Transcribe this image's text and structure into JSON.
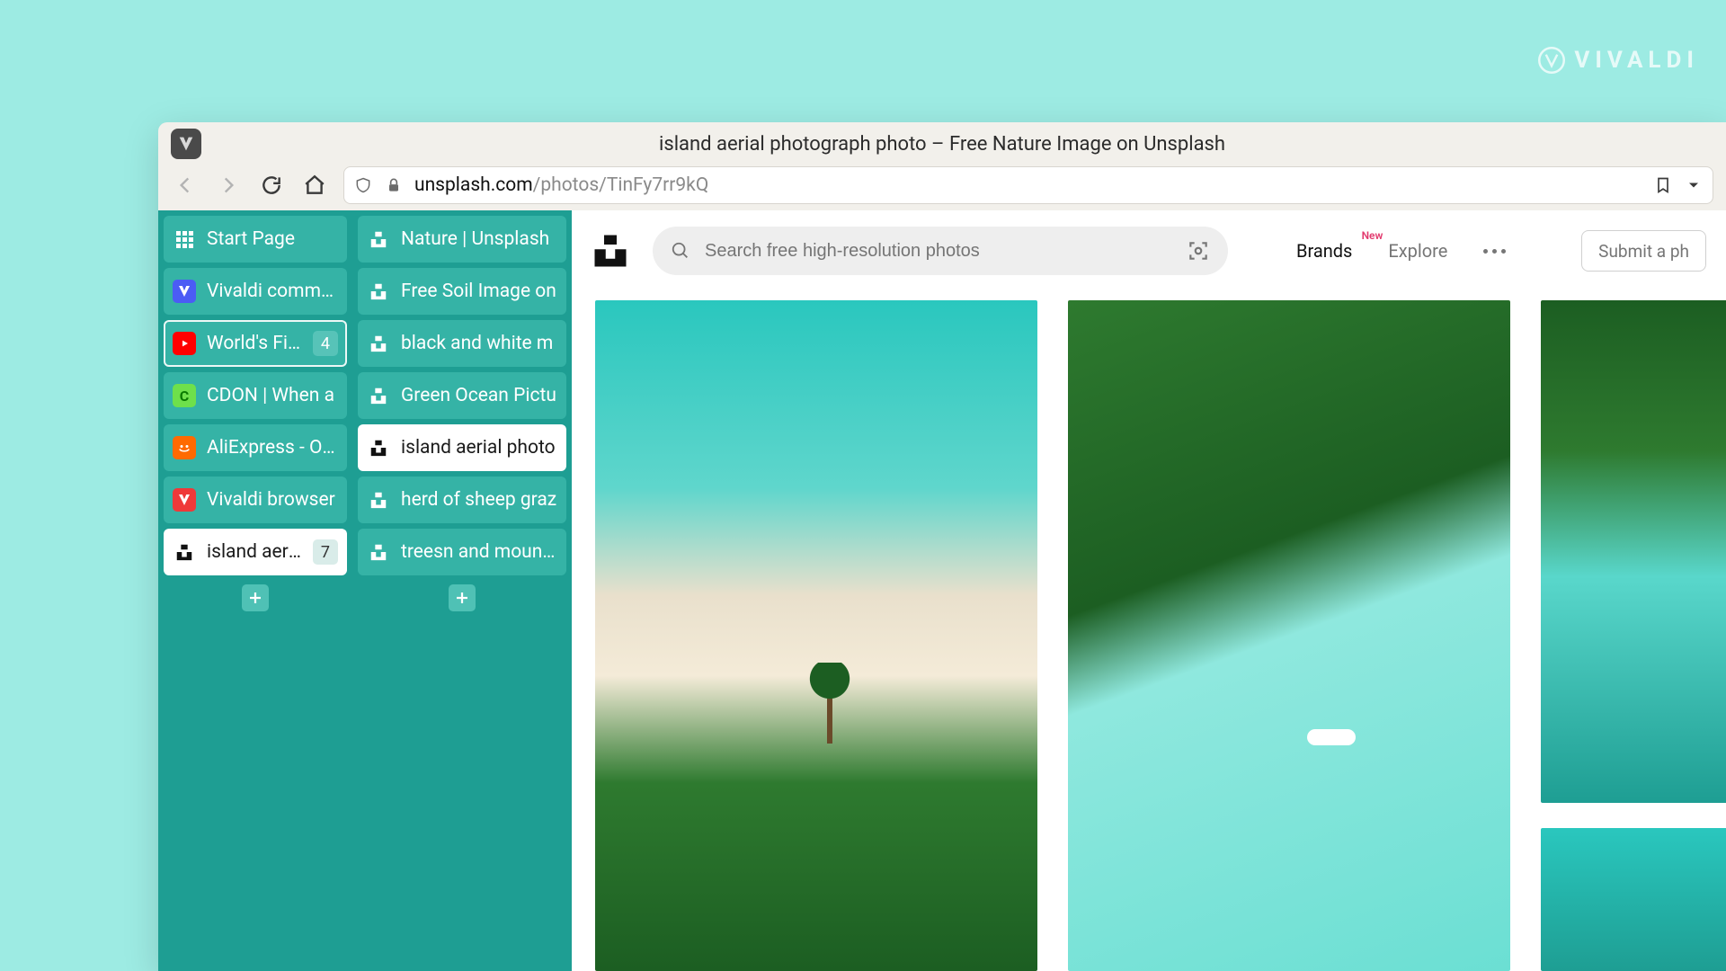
{
  "watermark": {
    "text": "VIVALDI"
  },
  "window": {
    "title": "island aerial photograph photo – Free Nature Image on Unsplash"
  },
  "address": {
    "host": "unsplash.com",
    "path": "/photos/TinFy7rr9kQ"
  },
  "tab_columns": {
    "a": [
      {
        "icon": "grid",
        "label": "Start Page"
      },
      {
        "icon": "vivaldi",
        "label": "Vivaldi commun"
      },
      {
        "icon": "youtube",
        "label": "World's Firs",
        "badge": "4",
        "outlined": true
      },
      {
        "icon": "cdon",
        "label": "CDON | When a"
      },
      {
        "icon": "ali",
        "label": "AliExpress - Onli"
      },
      {
        "icon": "vred",
        "label": "Vivaldi browser"
      },
      {
        "icon": "unsplash",
        "label": "island aerial",
        "badge": "7",
        "active_group": true
      }
    ],
    "b": [
      {
        "icon": "unsplash",
        "label": "Nature | Unsplash"
      },
      {
        "icon": "unsplash",
        "label": "Free Soil Image on"
      },
      {
        "icon": "unsplash",
        "label": "black and white m"
      },
      {
        "icon": "unsplash",
        "label": "Green Ocean Pictu"
      },
      {
        "icon": "unsplash",
        "label": "island aerial photo",
        "page_active": true
      },
      {
        "icon": "unsplash",
        "label": "herd of sheep graz"
      },
      {
        "icon": "unsplash",
        "label": "treesn and mounta"
      }
    ]
  },
  "site": {
    "search_placeholder": "Search free high-resolution photos",
    "links": {
      "brands": "Brands",
      "brands_badge": "New",
      "explore": "Explore"
    },
    "submit": "Submit a ph"
  }
}
